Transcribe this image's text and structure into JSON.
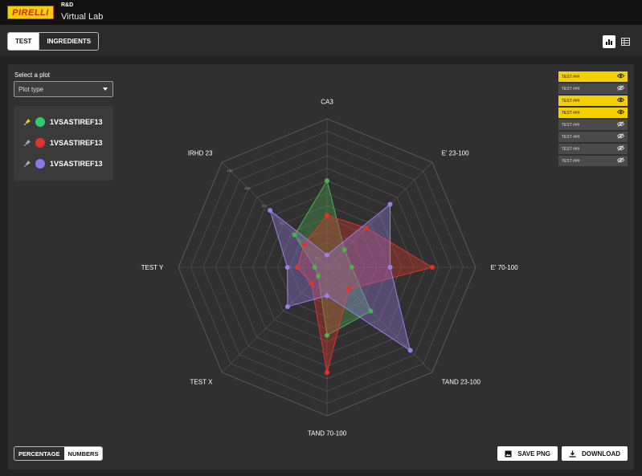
{
  "header": {
    "logo_text": "PIRELLI",
    "subtitle_small": "R&D",
    "app_title": "Virtual Lab"
  },
  "tabs": [
    {
      "label": "TEST"
    },
    {
      "label": "INGREDIENTS"
    }
  ],
  "sidebar": {
    "select_label": "Select a plot",
    "select_value": "Plot type",
    "series": [
      {
        "label": "1VSASTIREF13",
        "color": "#2ecc71",
        "pinned": true
      },
      {
        "label": "1VSASTIREF13",
        "color": "#e0332b",
        "pinned": false
      },
      {
        "label": "1VSASTIREF13",
        "color": "#8a78e8",
        "pinned": false
      }
    ]
  },
  "tests": [
    {
      "label": "TEST ###",
      "visible": true
    },
    {
      "label": "TEST ###",
      "visible": false
    },
    {
      "label": "TEST ###",
      "visible": true
    },
    {
      "label": "TEST ###",
      "visible": true
    },
    {
      "label": "TEST ###",
      "visible": false
    },
    {
      "label": "TEST ###",
      "visible": false
    },
    {
      "label": "TEST ###",
      "visible": false
    },
    {
      "label": "TEST ###",
      "visible": false
    }
  ],
  "units_toggle": {
    "options": [
      "PERCENTAGE",
      "NUMBERS"
    ],
    "selected": "NUMBERS"
  },
  "actions": {
    "save_png": "SAVE PNG",
    "download": "DOWNLOAD"
  },
  "colors": {
    "accent": "#f5d000",
    "green": "#4caf50",
    "red": "#e0332b",
    "purple": "#9b7fe6"
  },
  "chart_data": {
    "type": "radar",
    "axes": [
      "CA3",
      "E' 23-100",
      "E' 70-100",
      "TAND 23-100",
      "TAND 70-100",
      "TEST X",
      "TEST Y",
      "IRHD 23"
    ],
    "rlim": [
      0,
      120
    ],
    "ticks": [
      20,
      40,
      60,
      80,
      100,
      120
    ],
    "grid": true,
    "series": [
      {
        "color": "#4caf50",
        "values": [
          70,
          20,
          20,
          50,
          55,
          10,
          10,
          37
        ]
      },
      {
        "color": "#e0332b",
        "values": [
          42,
          45,
          85,
          25,
          85,
          18,
          24,
          26
        ]
      },
      {
        "color": "#9b7fe6",
        "values": [
          10,
          72,
          51,
          95,
          23,
          45,
          32,
          65
        ]
      }
    ]
  }
}
